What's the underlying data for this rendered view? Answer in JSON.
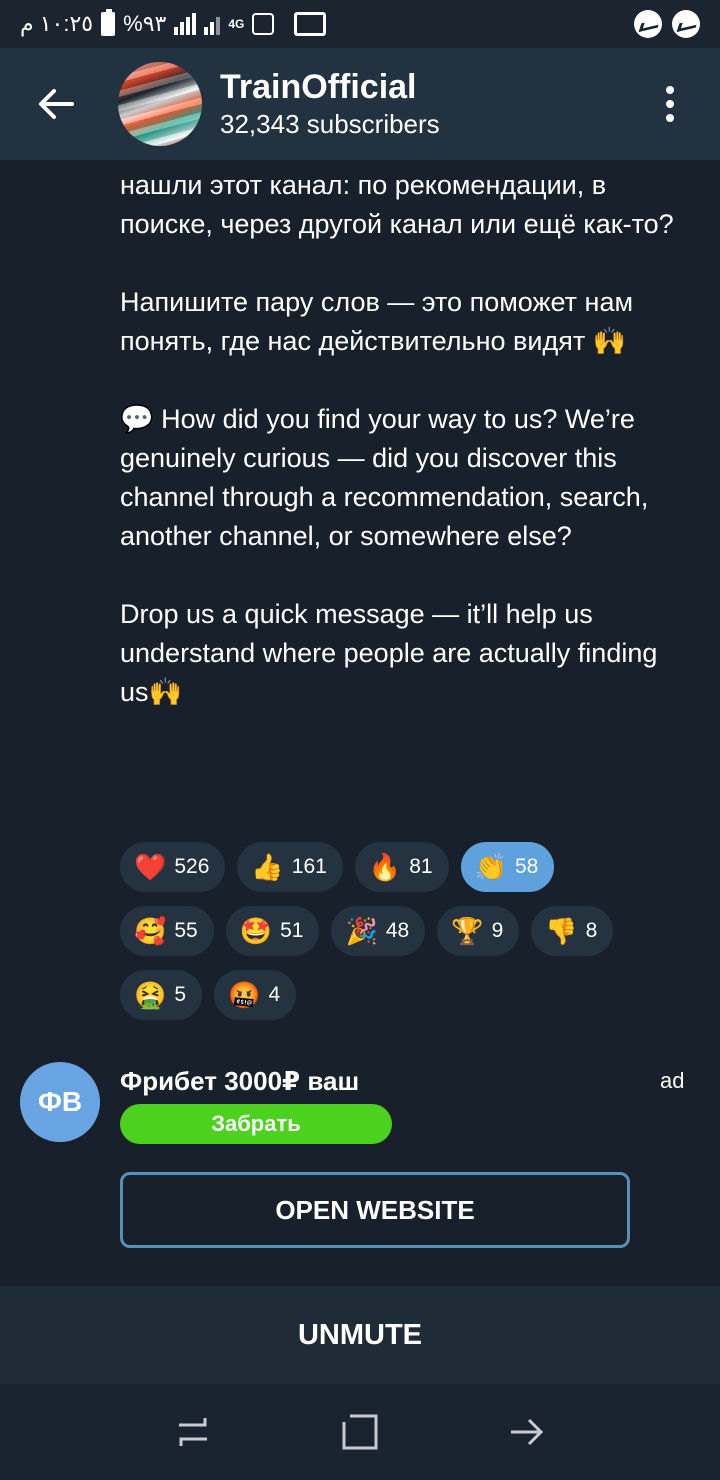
{
  "status_bar": {
    "time": "١٠:٢٥ م",
    "battery": "%٩٣",
    "network": "4G"
  },
  "header": {
    "channel_name": "TrainOfficial",
    "subscribers": "32,343 subscribers"
  },
  "message": {
    "paragraphs": [
      "нашли этот канал: по рекомендации, в поиске, через другой канал или ещё как-то?",
      "Напишите пару слов — это поможет нам понять, где нас действительно видят",
      "How did you find your way to us? We’re genuinely curious — did you discover this channel through a recommendation, search, another channel, or somewhere else?",
      "Drop us a quick message — it’ll help us understand where people are actually finding us"
    ],
    "emoji_raised_hands": "🙌",
    "emoji_speech": "💬"
  },
  "reactions": [
    {
      "emoji": "❤️",
      "count": "526"
    },
    {
      "emoji": "👍",
      "count": "161"
    },
    {
      "emoji": "🔥",
      "count": "81"
    },
    {
      "emoji": "👏",
      "count": "58",
      "active": true
    },
    {
      "emoji": "🥰",
      "count": "55"
    },
    {
      "emoji": "🤩",
      "count": "51"
    },
    {
      "emoji": "🎉",
      "count": "48"
    },
    {
      "emoji": "🏆",
      "count": "9"
    },
    {
      "emoji": "👎",
      "count": "8"
    },
    {
      "emoji": "🤮",
      "count": "5"
    },
    {
      "emoji": "🤬",
      "count": "4"
    }
  ],
  "ad": {
    "avatar_initials": "ФВ",
    "title": "Фрибет 3000₽ ваш",
    "label": "ad",
    "button": "Забрать",
    "open_website": "OPEN WEBSITE"
  },
  "bottom": {
    "unmute": "UNMUTE"
  },
  "colors": {
    "background": "#18202c",
    "header": "#233241",
    "accent_blue": "#5ea1dd",
    "ad_green": "#4cd11e"
  }
}
